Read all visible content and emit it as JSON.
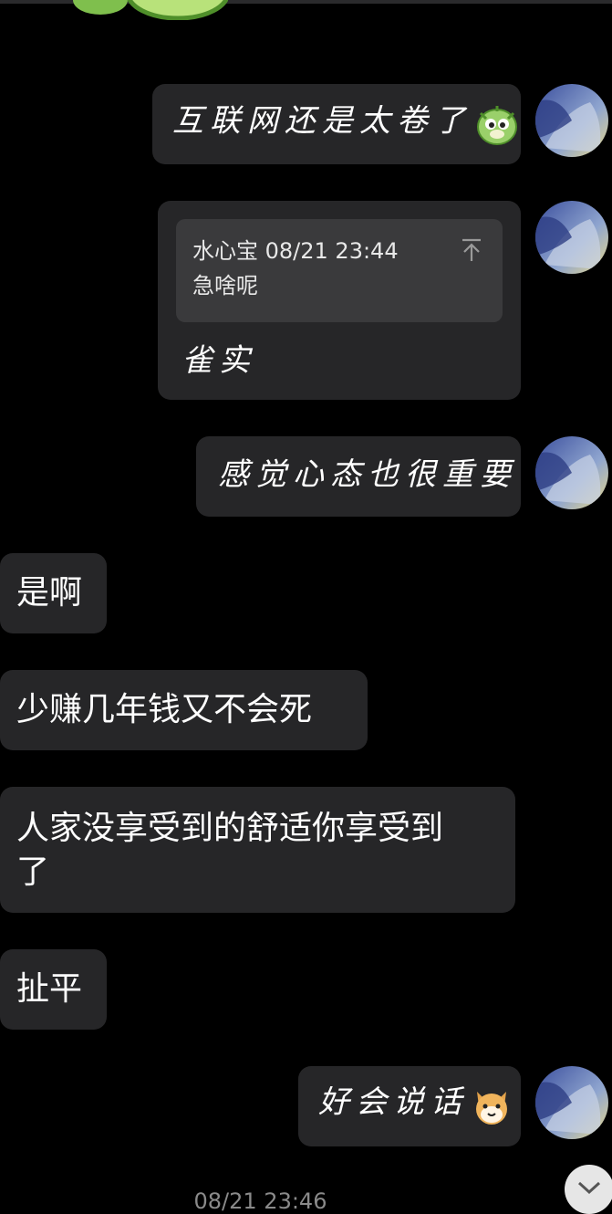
{
  "messages": [
    {
      "side": "right",
      "text": "互联网还是太卷了",
      "emoji": "dragon-sticker-icon"
    },
    {
      "side": "right",
      "quote": {
        "sender": "水心宝",
        "time": "08/21 23:44",
        "text": "急啥呢"
      },
      "text": "雀实"
    },
    {
      "side": "right",
      "text": "感觉心态也很重要"
    },
    {
      "side": "left",
      "text": "是啊"
    },
    {
      "side": "left",
      "text": "少赚几年钱又不会死"
    },
    {
      "side": "left",
      "text_line1": "人家没享受到的舒适你享受到",
      "text_line2": "了"
    },
    {
      "side": "left",
      "text": "扯平"
    },
    {
      "side": "right",
      "text": "好会说话",
      "emoji": "shiba-dog-icon"
    }
  ],
  "timestamp": "08/21 23:46",
  "colors": {
    "background": "#000000",
    "bubble": "#262628",
    "quote_box": "#3a3a3c",
    "timestamp": "#8a8a8a"
  }
}
